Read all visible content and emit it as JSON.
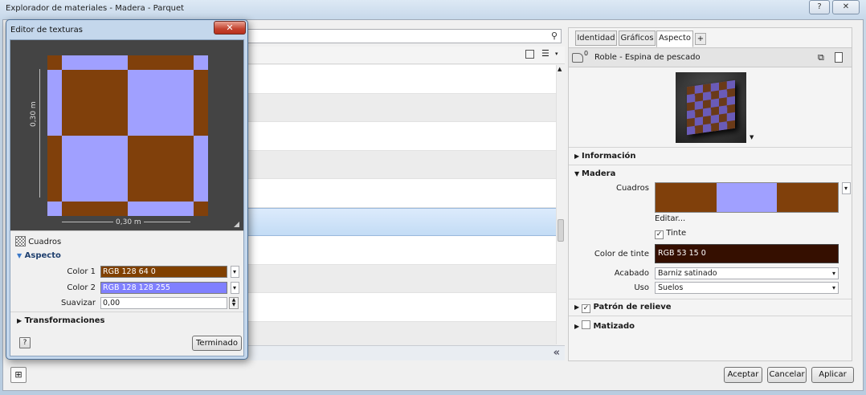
{
  "window": {
    "title": "Explorador de materiales - Madera - Parquet",
    "help_label": "?",
    "close_label": "✕"
  },
  "list": {
    "collapse_label": "«"
  },
  "right_panel": {
    "tabs": [
      {
        "label": "Identidad"
      },
      {
        "label": "Gráficos"
      },
      {
        "label": "Aspecto"
      },
      {
        "label": "+"
      }
    ],
    "usage_count": "0",
    "material_name": "Roble - Espina de pescado",
    "sections": {
      "informacion": "Información",
      "madera": "Madera",
      "patron": "Patrón de relieve",
      "matizado": "Matizado"
    },
    "cuadros_label": "Cuadros",
    "cuadros_colors": [
      "#80400b",
      "#a0a0ff",
      "#80400b"
    ],
    "editar_label": "Editar...",
    "tinte_label": "Tinte",
    "color_tinte_label": "Color de tinte",
    "color_tinte_value": "RGB 53 15 0",
    "color_tinte_hex": "#350f00",
    "acabado_label": "Acabado",
    "acabado_value": "Barniz satinado",
    "uso_label": "Uso",
    "uso_value": "Suelos"
  },
  "footer": {
    "accept": "Aceptar",
    "cancel": "Cancelar",
    "apply": "Aplicar"
  },
  "texture_editor": {
    "title": "Editor de texturas",
    "width_label": "0,30 m",
    "height_label": "0,30 m",
    "type_label": "Cuadros",
    "aspecto_label": "Aspecto",
    "color1_label": "Color 1",
    "color1_value": "RGB 128 64 0",
    "color1_hex": "#804000",
    "color2_label": "Color 2",
    "color2_value": "RGB 128 128 255",
    "color2_hex": "#8080ff",
    "suavizar_label": "Suavizar",
    "suavizar_value": "0,00",
    "transformaciones_label": "Transformaciones",
    "help_label": "?",
    "done_label": "Terminado"
  }
}
